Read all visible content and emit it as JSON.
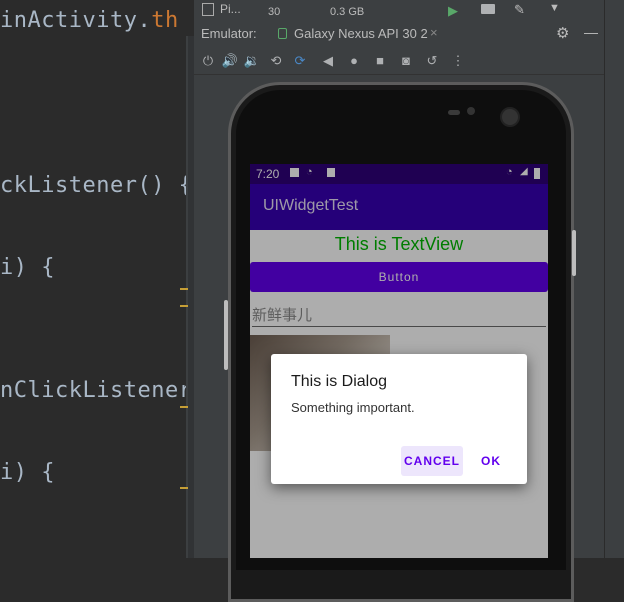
{
  "editor": {
    "lines": [
      {
        "text": "inActivity.",
        "accent": "th"
      },
      {
        "text": "ckListener() {"
      },
      {
        "text": "i) {"
      },
      {
        "text": "nClickListener"
      },
      {
        "text": "i) {"
      }
    ]
  },
  "topbar": {
    "left_label": "Pi...",
    "num": "30",
    "mem": "0.3 GB"
  },
  "emulator": {
    "label": "Emulator:",
    "tab_label": "Galaxy Nexus API 30 2",
    "tab_close": "×"
  },
  "toolbar_icons": [
    "power-icon",
    "volume-up-icon",
    "volume-down-icon",
    "rotate-left-icon",
    "rotate-right-icon",
    "back-icon",
    "home-icon",
    "overview-icon",
    "camera-icon",
    "replay-icon",
    "more-icon"
  ],
  "phone": {
    "status_time": "7:20",
    "app_title": "UIWidgetTest",
    "textview": "This is TextView",
    "button_label": "Button",
    "edittext_hint": "新鲜事儿",
    "dialog": {
      "title": "This is Dialog",
      "message": "Something important.",
      "cancel": "CANCEL",
      "ok": "OK"
    }
  },
  "colors": {
    "primary": "#6200ee",
    "primary_dark": "#3700b3",
    "textview": "#00b800"
  }
}
